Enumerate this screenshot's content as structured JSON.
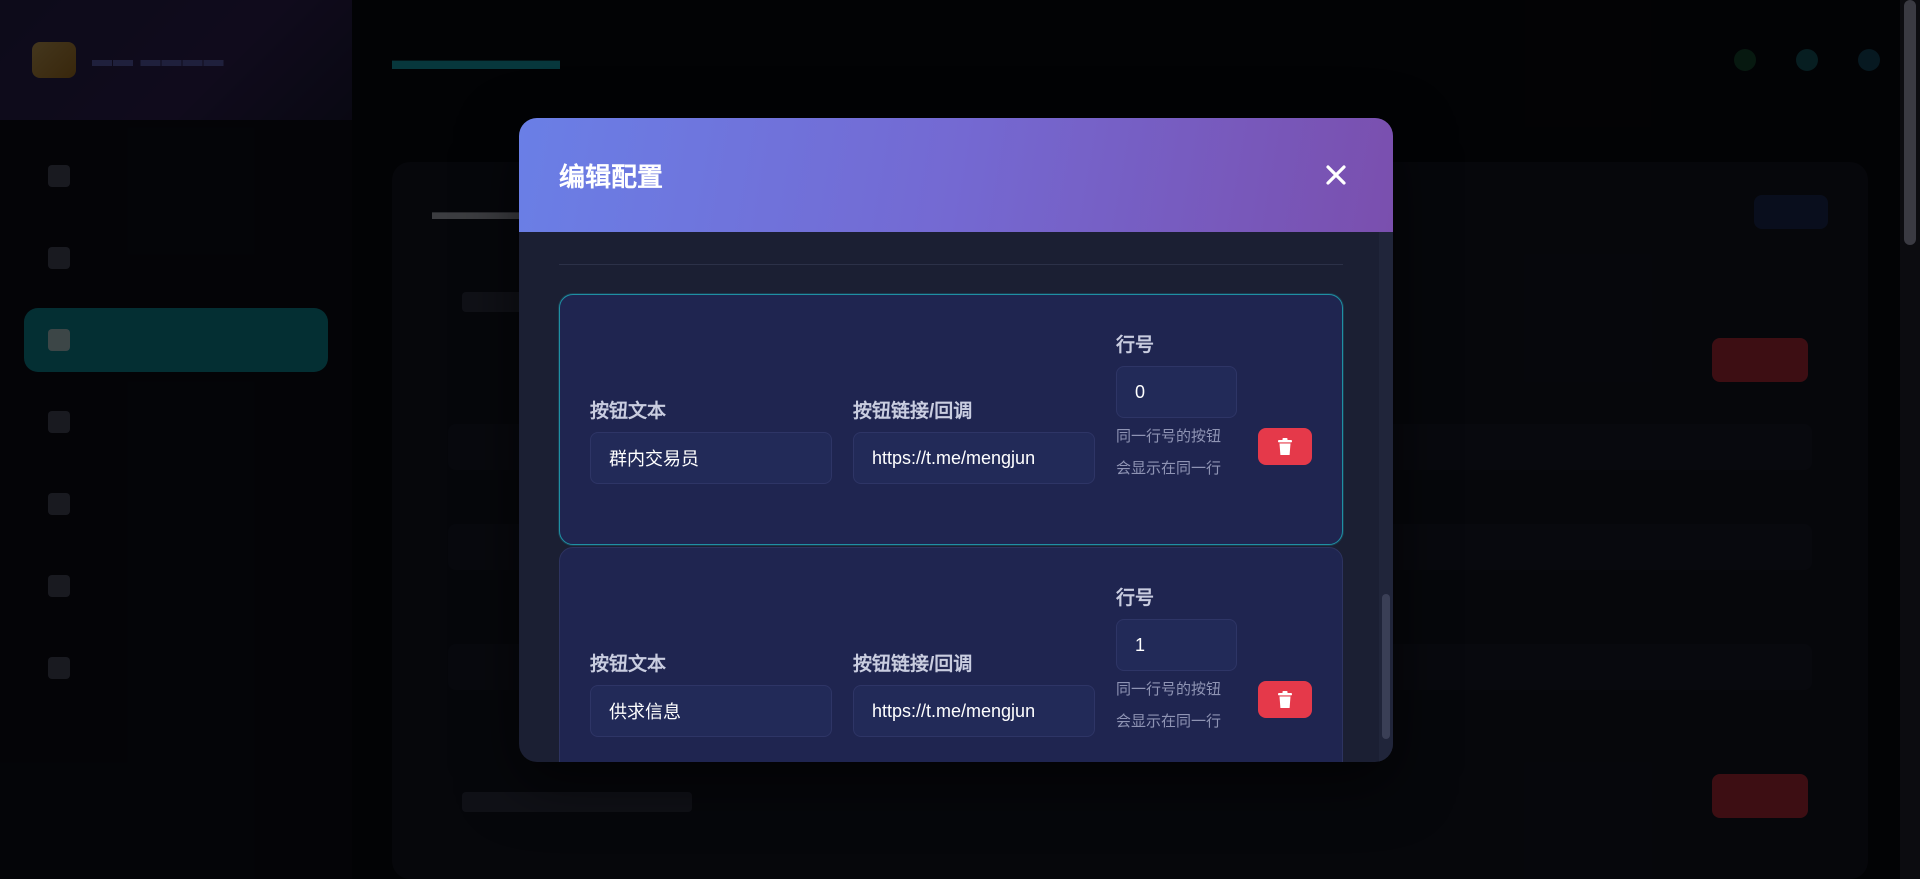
{
  "modal": {
    "title": "编辑配置",
    "buttons": [
      {
        "text_label": "按钮文本",
        "text_value": "群内交易员",
        "link_label": "按钮链接/回调",
        "link_value": "https://t.me/mengjun",
        "row_label": "行号",
        "row_value": "0",
        "hint_line1": "同一行号的按钮",
        "hint_line2": "会显示在同一行"
      },
      {
        "text_label": "按钮文本",
        "text_value": "供求信息",
        "link_label": "按钮链接/回调",
        "link_value": "https://t.me/mengjun",
        "row_label": "行号",
        "row_value": "1",
        "hint_line1": "同一行号的按钮",
        "hint_line2": "会显示在同一行"
      }
    ]
  },
  "icons": {
    "close": "close-icon",
    "delete": "trash-icon"
  },
  "colors": {
    "header_start": "#6a7fe6",
    "header_end": "#7a4fae",
    "delete_button": "#e5394a",
    "focus_border": "#1f8fa3",
    "active_nav": "#10a8b8"
  }
}
